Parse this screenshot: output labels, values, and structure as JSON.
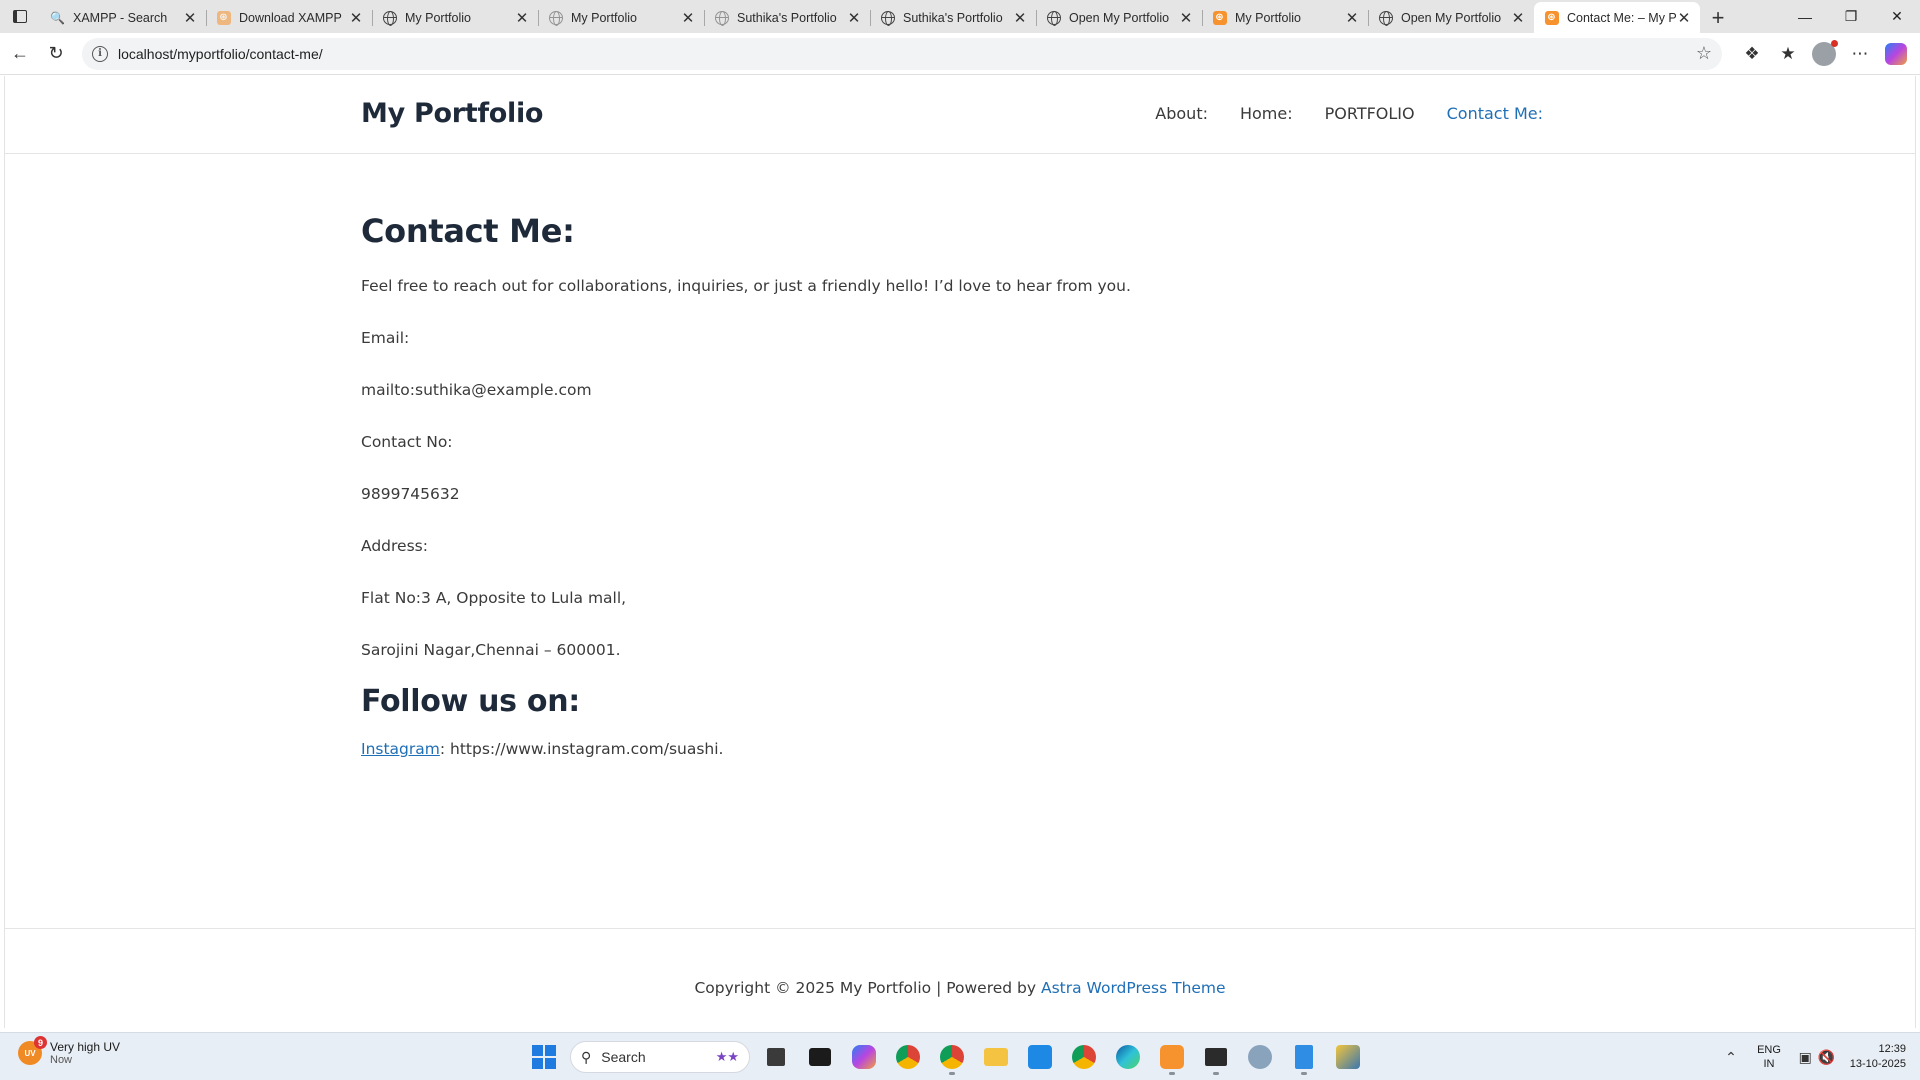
{
  "browser": {
    "tabs": [
      {
        "title": "XAMPP - Search",
        "favicon": "search-icon"
      },
      {
        "title": "Download XAMPP",
        "favicon": "xampp-icon"
      },
      {
        "title": "My Portfolio",
        "favicon": "globe-icon"
      },
      {
        "title": "My Portfolio",
        "favicon": "globe-icon"
      },
      {
        "title": "Suthika's Portfolio",
        "favicon": "globe-icon"
      },
      {
        "title": "Suthika's Portfolio",
        "favicon": "globe-icon"
      },
      {
        "title": "Open My Portfolio",
        "favicon": "globe-icon"
      },
      {
        "title": "My Portfolio",
        "favicon": "xampp-icon"
      },
      {
        "title": "Open My Portfolio",
        "favicon": "globe-icon"
      },
      {
        "title": "Contact Me: – My P",
        "favicon": "xampp-icon",
        "active": true
      }
    ],
    "url": "localhost/myportfolio/contact-me/"
  },
  "site": {
    "title": "My Portfolio",
    "nav": [
      "About:",
      "Home:",
      "PORTFOLIO",
      "Contact Me:"
    ],
    "active_nav": "Contact Me:",
    "accent_color": "#1f6fb6"
  },
  "content": {
    "heading": "Contact Me:",
    "intro": "Feel free to reach out for collaborations, inquiries, or just a friendly hello! I’d love to hear from you.",
    "email_label": "Email:",
    "email_value": "mailto:suthika@example.com",
    "contact_label": "Contact No:",
    "contact_value": "9899745632",
    "address_label": "Address:",
    "address_line1": "Flat No:3 A, Opposite to Lula mall,",
    "address_line2": "Sarojini Nagar,Chennai – 600001.",
    "follow_heading": "Follow us on:",
    "instagram_link": "Instagram",
    "instagram_url": ": https://www.instagram.com/suashi."
  },
  "footer": {
    "copyright": "Copyright © 2025 My Portfolio | Powered by ",
    "theme_link": "Astra WordPress Theme"
  },
  "taskbar": {
    "weather_badge": "9",
    "weather_uv": "UV",
    "weather_title": "Very high UV",
    "weather_time": "Now",
    "search_placeholder": "Search",
    "lang_line1": "ENG",
    "lang_line2": "IN",
    "time": "12:39",
    "date": "13-10-2025"
  }
}
